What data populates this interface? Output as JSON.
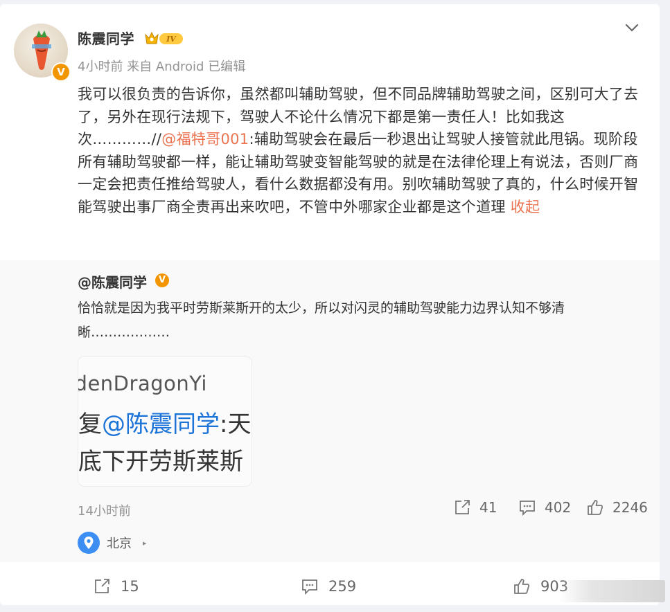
{
  "post": {
    "username": "陈震同学",
    "level_badge": "IV",
    "verified_icon": "v-badge",
    "meta": "4小时前 来自 Android 已编辑",
    "text_part1": "我可以很负责的告诉你，虽然都叫辅助驾驶，但不同品牌辅助驾驶之间，区别可大了去了，另外在现行法规下，驾驶人不论什么情况下都是第一责任人！比如我这次…………//",
    "mention": "@福特哥001",
    "text_part2": ":辅助驾驶会在最后一秒退出让驾驶人接管就此甩锅。现阶段所有辅助驾驶都一样，能让辅助驾驶变智能驾驶的就是在法律伦理上有说法，否则厂商一定会把责任推给驾驶人，看什么数据都没有用。别吹辅助驾驶了真的，什么时候开智能驾驶出事厂商全责再出来吹吧，不管中外哪家企业都是这个道理 ",
    "collapse": "收起"
  },
  "repost": {
    "username": "@陈震同学",
    "text": "恰恰就是因为我平时劳斯莱斯开的太少，所以对闪灵的辅助驾驶能力边界认知不够清晰………………",
    "thumbnail": {
      "line1": "ldenDragonYi",
      "line2_prefix": "复",
      "line2_mention": "@陈震同学",
      "line2_suffix": ":天",
      "line3": "底下开劳斯莱斯"
    },
    "time": "14小时前",
    "shares": "41",
    "comments": "402",
    "likes": "2246",
    "location": "北京"
  },
  "footer": {
    "shares": "15",
    "comments": "259",
    "likes": "903"
  },
  "colors": {
    "accent": "#eb7350",
    "verified": "#f39500",
    "location": "#3d8ef3"
  }
}
